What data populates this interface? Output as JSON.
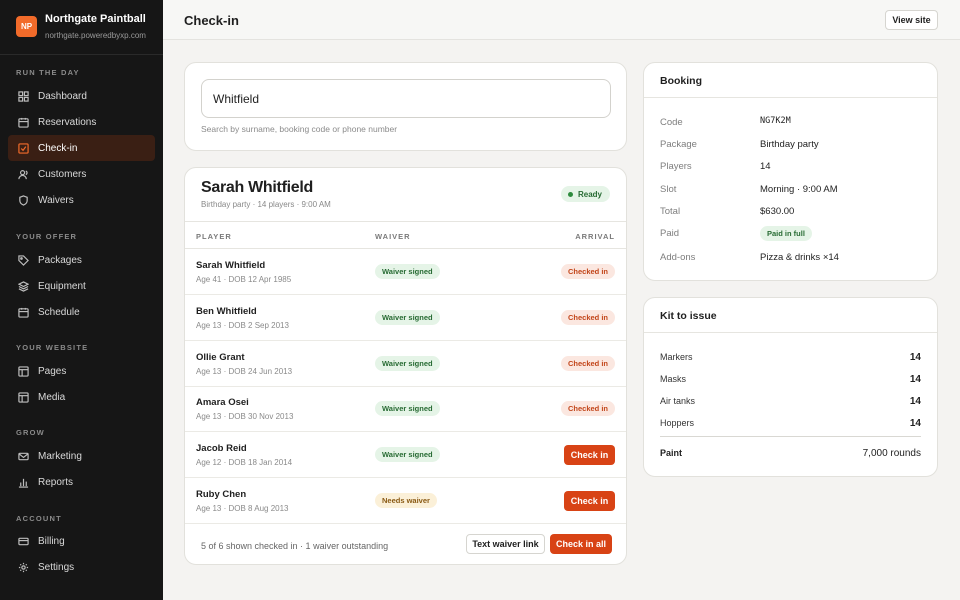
{
  "brand": {
    "logo": "NP",
    "name": "Northgate Paintball",
    "url": "northgate.poweredbyxp.com"
  },
  "sidebar": {
    "sections": [
      {
        "label": "RUN THE DAY"
      },
      {
        "label": "YOUR OFFER"
      },
      {
        "label": "YOUR WEBSITE"
      },
      {
        "label": "GROW"
      },
      {
        "label": "ACCOUNT"
      }
    ],
    "items": [
      {
        "label": "Dashboard",
        "icon": "grid-icon"
      },
      {
        "label": "Reservations",
        "icon": "calendar-icon"
      },
      {
        "label": "Check-in",
        "icon": "check-square-icon",
        "active": true
      },
      {
        "label": "Customers",
        "icon": "users-icon"
      },
      {
        "label": "Waivers",
        "icon": "shield-icon"
      },
      {
        "label": "Packages",
        "icon": "tag-icon"
      },
      {
        "label": "Equipment",
        "icon": "layers-icon"
      },
      {
        "label": "Schedule",
        "icon": "calendar-icon"
      },
      {
        "label": "Pages",
        "icon": "layout-icon"
      },
      {
        "label": "Media",
        "icon": "layout-icon"
      },
      {
        "label": "Marketing",
        "icon": "mail-icon"
      },
      {
        "label": "Reports",
        "icon": "bar-chart-icon"
      },
      {
        "label": "Billing",
        "icon": "credit-card-icon"
      },
      {
        "label": "Settings",
        "icon": "gear-icon"
      }
    ]
  },
  "header": {
    "title": "Check-in",
    "view_site": "View site"
  },
  "search": {
    "value": "Whitfield",
    "helper": "Search by surname, booking code or phone number"
  },
  "guest": {
    "name": "Sarah Whitfield",
    "subtitle": "Birthday party · 14 players · 9:00 AM",
    "status": "Ready",
    "columns": {
      "player": "PLAYER",
      "waiver": "WAIVER",
      "arrival": "ARRIVAL"
    },
    "players": [
      {
        "name": "Sarah Whitfield",
        "meta": "Age 41 · DOB 12 Apr 1985",
        "waiver": "Waiver signed",
        "waiver_state": "signed",
        "arrival": "Checked in",
        "arrival_state": "checked"
      },
      {
        "name": "Ben Whitfield",
        "meta": "Age 13 · DOB 2 Sep 2013",
        "waiver": "Waiver signed",
        "waiver_state": "signed",
        "arrival": "Checked in",
        "arrival_state": "checked"
      },
      {
        "name": "Ollie Grant",
        "meta": "Age 13 · DOB 24 Jun 2013",
        "waiver": "Waiver signed",
        "waiver_state": "signed",
        "arrival": "Checked in",
        "arrival_state": "checked"
      },
      {
        "name": "Amara Osei",
        "meta": "Age 13 · DOB 30 Nov 2013",
        "waiver": "Waiver signed",
        "waiver_state": "signed",
        "arrival": "Checked in",
        "arrival_state": "checked"
      },
      {
        "name": "Jacob Reid",
        "meta": "Age 12 · DOB 18 Jan 2014",
        "waiver": "Waiver signed",
        "waiver_state": "signed",
        "arrival": "Check in",
        "arrival_state": "button"
      },
      {
        "name": "Ruby Chen",
        "meta": "Age 13 · DOB 8 Aug 2013",
        "waiver": "Needs waiver",
        "waiver_state": "needs",
        "arrival": "Check in",
        "arrival_state": "button"
      }
    ],
    "footer_text": "5 of 6 shown checked in · 1 waiver outstanding",
    "text_waiver_link": "Text waiver link",
    "check_in_all": "Check in all"
  },
  "booking": {
    "title": "Booking",
    "fields": [
      {
        "label": "Code",
        "value": "NG7K2M"
      },
      {
        "label": "Package",
        "value": "Birthday party"
      },
      {
        "label": "Players",
        "value": "14"
      },
      {
        "label": "Slot",
        "value": "Morning · 9:00 AM"
      },
      {
        "label": "Total",
        "value": "$630.00"
      },
      {
        "label": "Paid",
        "value": "Paid in full"
      },
      {
        "label": "Add-ons",
        "value": "Pizza & drinks ×14"
      }
    ]
  },
  "kit": {
    "title": "Kit to issue",
    "items": [
      {
        "label": "Markers",
        "value": "14"
      },
      {
        "label": "Masks",
        "value": "14"
      },
      {
        "label": "Air tanks",
        "value": "14"
      },
      {
        "label": "Hoppers",
        "value": "14"
      }
    ],
    "paint": {
      "label": "Paint",
      "value": "7,000 rounds"
    }
  },
  "colors": {
    "accent": "#d84315",
    "brand": "#f26b2a",
    "sidebar_bg": "#161616",
    "success": "#276b33"
  }
}
